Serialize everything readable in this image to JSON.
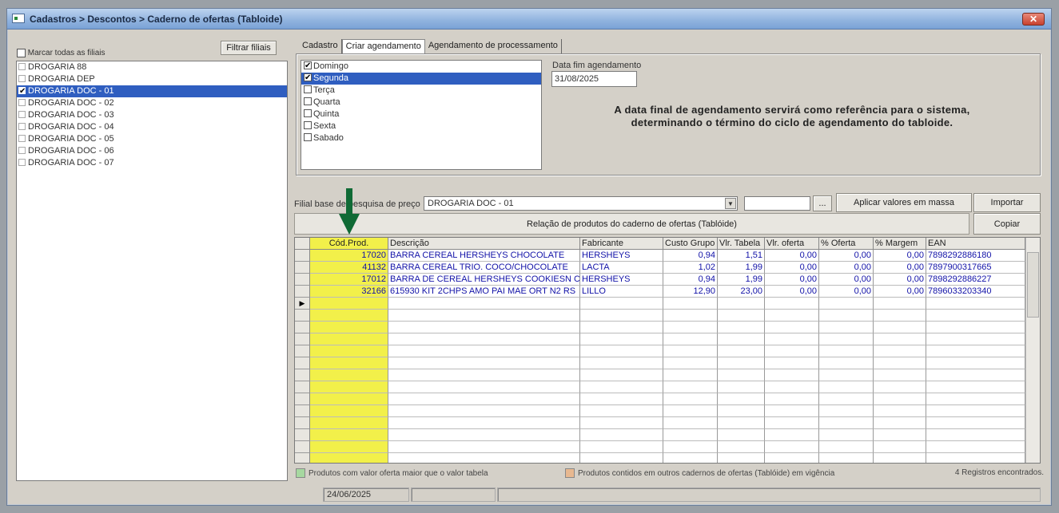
{
  "window": {
    "title": "Cadastros > Descontos > Caderno de ofertas (Tabloide)"
  },
  "left": {
    "filter_button": "Filtrar filiais",
    "select_all_label": "Marcar todas as filiais",
    "filiais": [
      {
        "label": "DROGARIA 88",
        "checked": false,
        "selected": false
      },
      {
        "label": "DROGARIA DEP",
        "checked": false,
        "selected": false
      },
      {
        "label": "DROGARIA DOC - 01",
        "checked": true,
        "selected": true
      },
      {
        "label": "DROGARIA DOC - 02",
        "checked": false,
        "selected": false
      },
      {
        "label": "DROGARIA DOC - 03",
        "checked": false,
        "selected": false
      },
      {
        "label": "DROGARIA DOC - 04",
        "checked": false,
        "selected": false
      },
      {
        "label": "DROGARIA DOC - 05",
        "checked": false,
        "selected": false
      },
      {
        "label": "DROGARIA DOC - 06",
        "checked": false,
        "selected": false
      },
      {
        "label": "DROGARIA DOC - 07",
        "checked": false,
        "selected": false
      }
    ]
  },
  "tabs": [
    "Cadastro",
    "Criar agendamento",
    "Agendamento de processamento"
  ],
  "schedule": {
    "days": [
      {
        "label": "Domingo",
        "checked": true,
        "selected": false
      },
      {
        "label": "Segunda",
        "checked": true,
        "selected": true
      },
      {
        "label": "Terça",
        "checked": false,
        "selected": false
      },
      {
        "label": "Quarta",
        "checked": false,
        "selected": false
      },
      {
        "label": "Quinta",
        "checked": false,
        "selected": false
      },
      {
        "label": "Sexta",
        "checked": false,
        "selected": false
      },
      {
        "label": "Sabado",
        "checked": false,
        "selected": false
      }
    ],
    "date_label": "Data fim agendamento",
    "date_value": "31/08/2025",
    "notice_line1": "A data final de agendamento servirá como referência para o sistema,",
    "notice_line2": "determinando o término do ciclo de agendamento do tabloide."
  },
  "price": {
    "label": "Filial base de pesquisa de preço",
    "selected": "DROGARIA DOC - 01",
    "dots_button": "...",
    "apply_button": "Aplicar valores em massa",
    "import_button": "Importar"
  },
  "grid": {
    "title": "Relação de produtos do caderno de ofertas (Tablóide)",
    "copy_button": "Copiar",
    "columns": [
      "Cód.Prod.",
      "Descrição",
      "Fabricante",
      "Custo Grupo",
      "Vlr. Tabela",
      "Vlr. oferta",
      "% Oferta",
      "% Margem",
      "EAN"
    ],
    "rows": [
      [
        "17020",
        "BARRA CEREAL HERSHEYS CHOCOLATE",
        "HERSHEYS",
        "0,94",
        "1,51",
        "0,00",
        "0,00",
        "0,00",
        "7898292886180"
      ],
      [
        "41132",
        "BARRA CEREAL TRIO. COCO/CHOCOLATE",
        "LACTA",
        "1,02",
        "1,99",
        "0,00",
        "0,00",
        "0,00",
        "7897900317665"
      ],
      [
        "17012",
        "BARRA DE CEREAL HERSHEYS COOKIESN CF",
        "HERSHEYS",
        "0,94",
        "1,99",
        "0,00",
        "0,00",
        "0,00",
        "7898292886227"
      ],
      [
        "32166",
        "615930 KIT 2CHPS AMO PAI  MAE ORT N2 RS",
        "LILLO",
        "12,90",
        "23,00",
        "0,00",
        "0,00",
        "0,00",
        "7896033203340"
      ]
    ],
    "new_row_marker": "▶"
  },
  "legend": {
    "green_label": "Produtos com valor oferta maior que o valor tabela",
    "green_color": "#a6d8a0",
    "orange_label": "Produtos contidos em outros cadernos de ofertas (Tablóide) em vigência",
    "orange_color": "#e8b890",
    "records": "4 Registros encontrados."
  },
  "status": {
    "date": "24/06/2025"
  }
}
